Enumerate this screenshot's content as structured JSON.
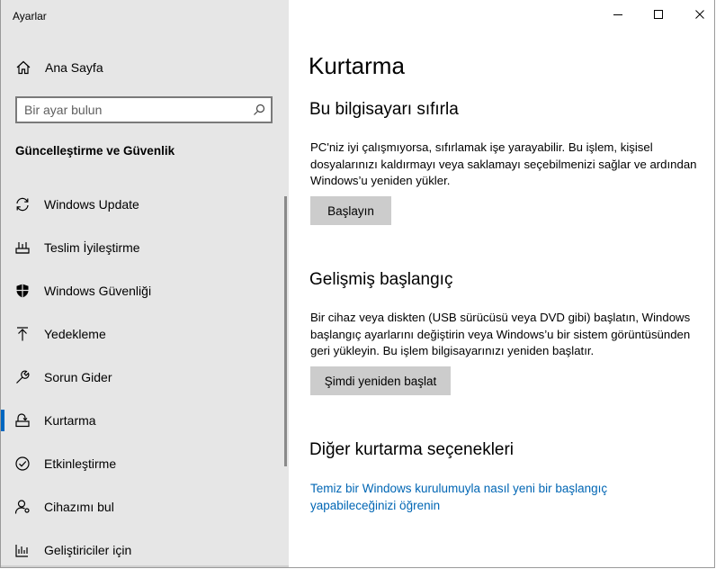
{
  "window": {
    "title": "Ayarlar",
    "controls": {
      "minimize": "minimize-icon",
      "maximize": "maximize-icon",
      "close": "close-icon"
    }
  },
  "sidebar": {
    "home": {
      "label": "Ana Sayfa",
      "icon": "home-icon"
    },
    "search": {
      "placeholder": "Bir ayar bulun",
      "value": "",
      "icon": "search-icon"
    },
    "section_heading": "Güncelleştirme ve Güvenlik",
    "items": [
      {
        "label": "Windows Update",
        "icon": "refresh-icon",
        "active": false
      },
      {
        "label": "Teslim İyileştirme",
        "icon": "delivery-icon",
        "active": false
      },
      {
        "label": "Windows Güvenliği",
        "icon": "shield-icon",
        "active": false
      },
      {
        "label": "Yedekleme",
        "icon": "upload-arrow-icon",
        "active": false
      },
      {
        "label": "Sorun Gider",
        "icon": "wrench-icon",
        "active": false
      },
      {
        "label": "Kurtarma",
        "icon": "recovery-icon",
        "active": true
      },
      {
        "label": "Etkinleştirme",
        "icon": "checkmark-circle-icon",
        "active": false
      },
      {
        "label": "Cihazımı bul",
        "icon": "person-location-icon",
        "active": false
      },
      {
        "label": "Geliştiriciler için",
        "icon": "developer-icon",
        "active": false
      }
    ]
  },
  "main": {
    "title": "Kurtarma",
    "reset": {
      "heading": "Bu bilgisayarı sıfırla",
      "description": "PC'niz iyi çalışmıyorsa, sıfırlamak işe yarayabilir. Bu işlem, kişisel dosyalarınızı kaldırmayı veya saklamayı seçebilmenizi sağlar ve ardından Windows’u yeniden yükler.",
      "button": "Başlayın"
    },
    "advanced": {
      "heading": "Gelişmiş başlangıç",
      "description": "Bir cihaz veya diskten (USB sürücüsü veya DVD gibi) başlatın, Windows başlangıç ayarlarını değiştirin veya Windows’u bir sistem görüntüsünden geri yükleyin. Bu işlem bilgisayarınızı yeniden başlatır.",
      "button": "Şimdi yeniden başlat"
    },
    "more": {
      "heading": "Diğer kurtarma seçenekleri",
      "link": "Temiz bir Windows kurulumuyla nasıl yeni bir başlangıç yapabileceğinizi öğrenin"
    }
  },
  "colors": {
    "accent": "#0067c0",
    "link": "#0066b4",
    "sidebar_bg": "#e6e6e6",
    "button_bg": "#cccccc"
  }
}
